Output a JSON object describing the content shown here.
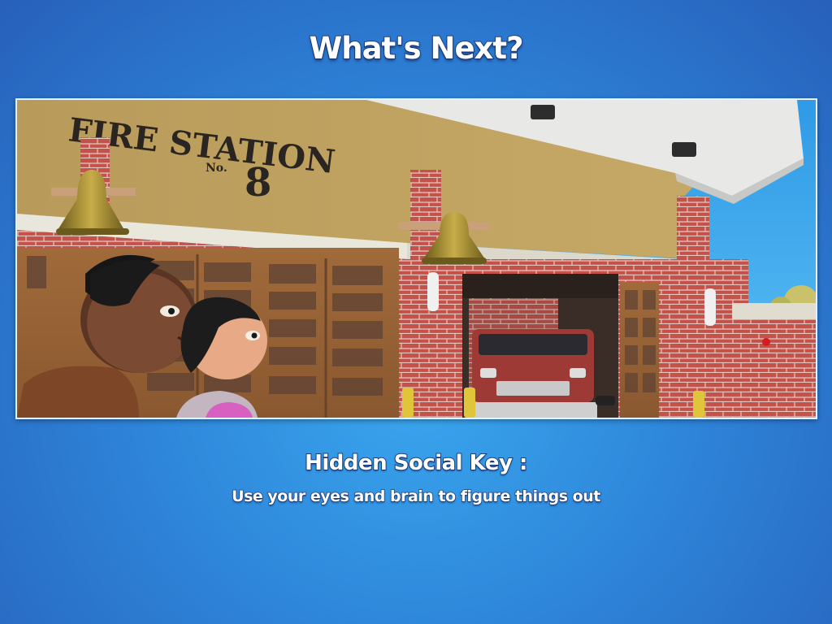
{
  "title": "What's Next?",
  "scene": {
    "sign": {
      "line1": "FIRE STATION",
      "number_prefix": "No.",
      "number": "8"
    }
  },
  "hidden_social_key": {
    "heading": "Hidden Social Key :",
    "description": "Use your eyes and brain to figure things out"
  }
}
